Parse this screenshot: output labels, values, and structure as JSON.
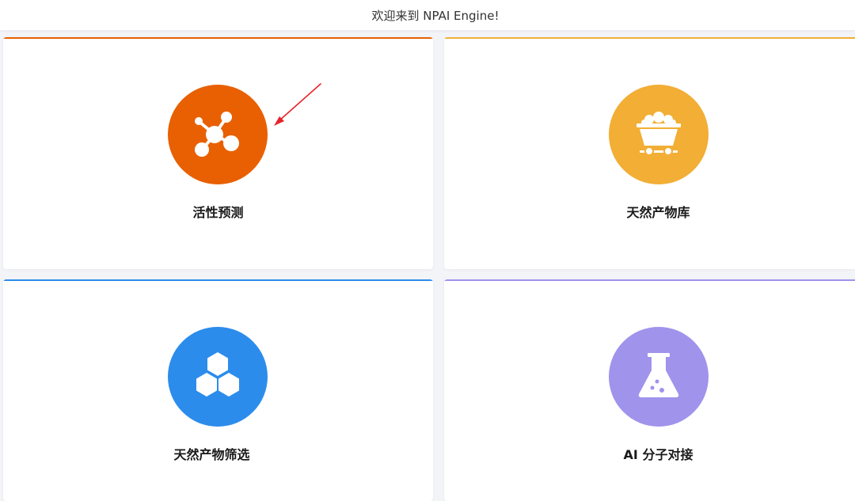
{
  "header": {
    "title": "欢迎来到 NPAI Engine!"
  },
  "cards": [
    {
      "label": "活性预测",
      "icon": "molecule-icon",
      "color": "#e86001"
    },
    {
      "label": "天然产物库",
      "icon": "mine-cart-icon",
      "color": "#f2ae35"
    },
    {
      "label": "天然产物筛选",
      "icon": "hexagon-cluster-icon",
      "color": "#2b8cec"
    },
    {
      "label": "AI 分子对接",
      "icon": "flask-icon",
      "color": "#a093ec"
    }
  ],
  "annotation": {
    "icon": "red-arrow-icon",
    "color": "#e8222a"
  }
}
